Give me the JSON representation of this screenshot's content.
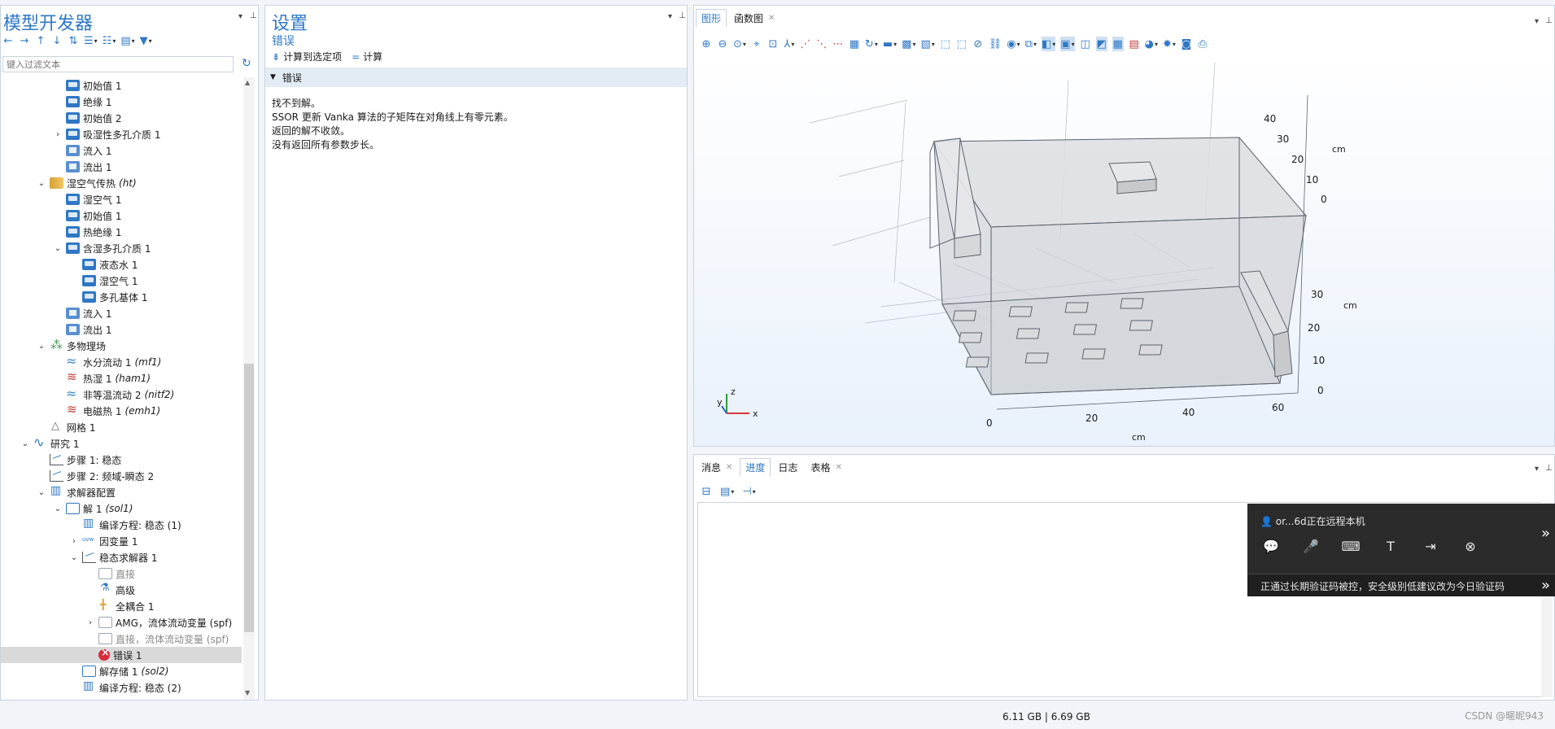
{
  "model_builder": {
    "title": "模型开发器",
    "filter_placeholder": "键入过滤文本",
    "tree": [
      {
        "label": "初始值 1",
        "icon": "blue"
      },
      {
        "label": "绝缘 1",
        "icon": "blue"
      },
      {
        "label": "初始值 2",
        "icon": "blue"
      },
      {
        "label": "吸湿性多孔介质 1",
        "icon": "blue",
        "toggle": ">"
      },
      {
        "label": "流入 1",
        "icon": "blue2"
      },
      {
        "label": "流出 1",
        "icon": "blue2"
      },
      {
        "label": "湿空气传热",
        "suffix": "(ht)",
        "icon": "heat",
        "toggle": "v"
      },
      {
        "label": "湿空气 1",
        "icon": "blue"
      },
      {
        "label": "初始值 1",
        "icon": "blue"
      },
      {
        "label": "热绝缘 1",
        "icon": "blue"
      },
      {
        "label": "含湿多孔介质 1",
        "icon": "blue",
        "toggle": "v"
      },
      {
        "label": "液态水 1",
        "icon": "blue"
      },
      {
        "label": "湿空气 1",
        "icon": "blue"
      },
      {
        "label": "多孔基体 1",
        "icon": "blue"
      },
      {
        "label": "流入 1",
        "icon": "blue2"
      },
      {
        "label": "流出 1",
        "icon": "blue2"
      },
      {
        "label": "多物理场",
        "icon": "multi",
        "toggle": "v"
      },
      {
        "label": "水分流动 1",
        "suffix": "(mf1)",
        "icon": "wave"
      },
      {
        "label": "热湿 1",
        "suffix": "(ham1)",
        "icon": "red"
      },
      {
        "label": "非等温流动 2",
        "suffix": "(nitf2)",
        "icon": "wave"
      },
      {
        "label": "电磁热 1",
        "suffix": "(emh1)",
        "icon": "red"
      },
      {
        "label": "网格 1",
        "icon": "mesh"
      },
      {
        "label": "研究 1",
        "icon": "study",
        "toggle": "v"
      },
      {
        "label": "步骤 1: 稳态",
        "icon": "step"
      },
      {
        "label": "步骤 2: 频域-瞬态 2",
        "icon": "step"
      },
      {
        "label": "求解器配置",
        "icon": "solcfg",
        "toggle": "v"
      },
      {
        "label": "解 1",
        "suffix": "(sol1)",
        "icon": "sol",
        "toggle": "v"
      },
      {
        "label": "编译方程: 稳态 (1)",
        "icon": "solcfg"
      },
      {
        "label": "因变量 1",
        "icon": "dep",
        "toggle": ">"
      },
      {
        "label": "稳态求解器 1",
        "icon": "step",
        "toggle": "v"
      },
      {
        "label": "直接",
        "icon": "direct",
        "gray": true
      },
      {
        "label": "高级",
        "icon": "adv"
      },
      {
        "label": "全耦合 1",
        "icon": "full"
      },
      {
        "label": "AMG，流体流动变量 (spf)",
        "icon": "direct",
        "toggle": ">"
      },
      {
        "label": "直接，流体流动变量 (spf)",
        "icon": "direct",
        "gray": true
      },
      {
        "label": "错误 1",
        "icon": "err",
        "selected": true
      },
      {
        "label": "解存储 1",
        "suffix": "(sol2)",
        "icon": "store"
      },
      {
        "label": "编译方程: 稳态 (2)",
        "icon": "solcfg"
      }
    ]
  },
  "settings": {
    "title": "设置",
    "subtitle": "错误",
    "action_compute_selected": "计算到选定项",
    "action_compute": "计算",
    "section_title": "错误",
    "error_lines": [
      "找不到解。",
      "SSOR 更新 Vanka 算法的子矩阵在对角线上有零元素。",
      "返回的解不收敛。",
      "没有返回所有参数步长。"
    ]
  },
  "graphics": {
    "tabs": [
      {
        "label": "图形",
        "active": true
      },
      {
        "label": "函数图",
        "active": false,
        "closable": true
      }
    ],
    "axes": {
      "x_ticks": [
        "0",
        "20",
        "40",
        "60"
      ],
      "x_unit": "cm",
      "y_ticks": [
        "0",
        "10",
        "20",
        "30",
        "40"
      ],
      "y_unit": "cm",
      "z_ticks": [
        "0",
        "10",
        "20",
        "30"
      ],
      "z_unit": "cm",
      "triad": {
        "x": "x",
        "y": "y",
        "z": "z"
      }
    }
  },
  "messages": {
    "tabs": [
      {
        "label": "消息",
        "active": false,
        "closable": true
      },
      {
        "label": "进度",
        "active": true,
        "closable": false
      },
      {
        "label": "日志",
        "active": false,
        "closable": false
      },
      {
        "label": "表格",
        "active": false,
        "closable": true
      }
    ]
  },
  "remote": {
    "status": "or...6d正在远程本机",
    "warning": "正通过长期验证码被控，安全级别低建议改为今日验证码"
  },
  "status_bar": {
    "memory": "6.11 GB | 6.69 GB",
    "watermark": "CSDN @暱昵943"
  }
}
